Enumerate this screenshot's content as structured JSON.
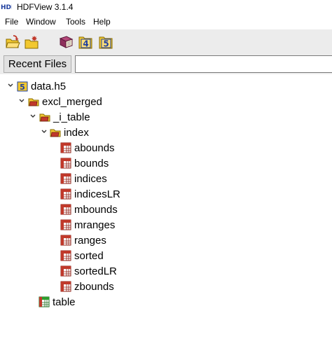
{
  "window": {
    "logo_text": "HDF",
    "title": "HDFView 3.1.4"
  },
  "menu": {
    "items": [
      "File",
      "Window",
      "Tools",
      "Help"
    ]
  },
  "toolbar": {
    "buttons": [
      {
        "icon": "open-folder-icon"
      },
      {
        "icon": "new-folder-icon"
      },
      {
        "icon": "help-book-icon"
      },
      {
        "icon": "hdf4-library-icon",
        "label": "4"
      },
      {
        "icon": "hdf5-library-icon",
        "label": "5"
      }
    ]
  },
  "recent": {
    "button_label": "Recent Files",
    "field_value": ""
  },
  "tree": {
    "root": {
      "label": "data.h5",
      "icon": "hdf5-file-icon",
      "expanded": true
    },
    "group1": {
      "label": "excl_merged",
      "icon": "group-folder-icon",
      "expanded": true
    },
    "group2": {
      "label": "_i_table",
      "icon": "group-folder-icon",
      "expanded": true
    },
    "group3": {
      "label": "index",
      "icon": "group-folder-icon",
      "expanded": true
    },
    "datasets": [
      "abounds",
      "bounds",
      "indices",
      "indicesLR",
      "mbounds",
      "mranges",
      "ranges",
      "sorted",
      "sortedLR",
      "zbounds"
    ],
    "table": {
      "label": "table",
      "icon": "compound-table-icon"
    }
  },
  "colors": {
    "folder": "#f2c830",
    "group_red": "#c0392b",
    "hdf_blue": "#1f3f9f",
    "chrome_bg": "#ececec"
  }
}
